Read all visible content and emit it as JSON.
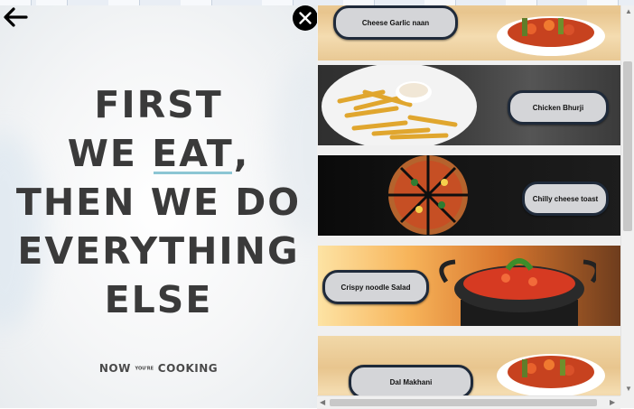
{
  "poster": {
    "lines": [
      "FIRST",
      "WE",
      "EAT",
      ",",
      "THEN WE DO",
      "EVERYTHING",
      "ELSE"
    ],
    "brand": {
      "left": "NOW",
      "middle": "YOU'RE",
      "right": "COOKING"
    }
  },
  "menu": {
    "items": [
      {
        "label": "Cheese Garlic naan"
      },
      {
        "label": "Chicken Bhurji"
      },
      {
        "label": "Chilly cheese toast"
      },
      {
        "label": "Crispy noodle Salad"
      },
      {
        "label": "Dal Makhani"
      }
    ]
  },
  "icons": {
    "back": "arrow-left-icon",
    "close": "close-icon"
  },
  "colors": {
    "pill_border": "#1f2a3a",
    "pill_fill": "#d4d5d8",
    "close_bg": "#000000",
    "underline": "#8cc6d4"
  }
}
